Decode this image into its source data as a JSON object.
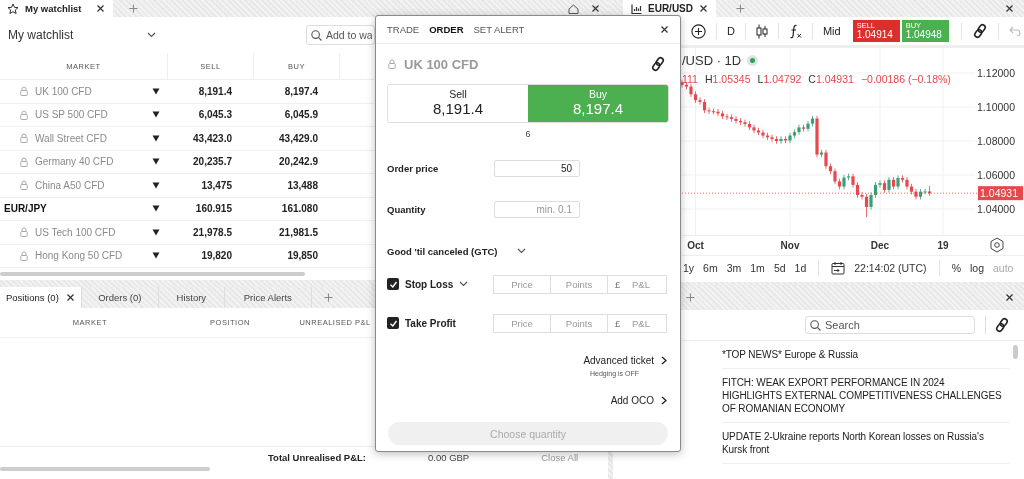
{
  "watchlist": {
    "tab": {
      "label": "My watchlist"
    },
    "title": "My watchlist",
    "search": {
      "placeholder": "Add to wa"
    },
    "columns": [
      "MARKET",
      "SELL",
      "BUY"
    ],
    "rows": [
      {
        "market": "UK 100 CFD",
        "locked": true,
        "sell": "8,191.4",
        "buy": "8,197.4"
      },
      {
        "market": "US SP 500 CFD",
        "locked": true,
        "sell": "6,045.3",
        "buy": "6,045.9"
      },
      {
        "market": "Wall Street CFD",
        "locked": true,
        "sell": "43,423.0",
        "buy": "43,429.0"
      },
      {
        "market": "Germany 40 CFD",
        "locked": true,
        "sell": "20,235.7",
        "buy": "20,242.9"
      },
      {
        "market": "China A50 CFD",
        "locked": true,
        "sell": "13,475",
        "buy": "13,488"
      },
      {
        "market": "EUR/JPY",
        "locked": false,
        "sell": "160.915",
        "buy": "161.080"
      },
      {
        "market": "US Tech 100 CFD",
        "locked": true,
        "sell": "21,978.5",
        "buy": "21,981.5"
      },
      {
        "market": "Hong Kong 50 CFD",
        "locked": true,
        "sell": "19,820",
        "buy": "19,850"
      }
    ]
  },
  "positions": {
    "tabs": [
      {
        "label": "Positions (0)",
        "selected": true
      },
      {
        "label": "Orders (0)",
        "selected": false
      },
      {
        "label": "History",
        "selected": false
      },
      {
        "label": "Price Alerts",
        "selected": false
      }
    ],
    "columns": [
      "MARKET",
      "POSITION",
      "UNREALISED P&L"
    ],
    "footer": {
      "label": "Total Unrealised P&L:",
      "value": "0.00 GBP",
      "action": "Close All"
    }
  },
  "chart": {
    "tab": {
      "label": "EUR/USD"
    },
    "toolbar": {
      "interval": "D",
      "price_type": "Mid",
      "quotes": [
        {
          "kind": "sell",
          "label": "SELL",
          "value": "1.04914"
        },
        {
          "kind": "buy",
          "label": "BUY",
          "value": "1.04948"
        }
      ]
    },
    "title": "/USD · 1D",
    "ohlc_cut": "111",
    "ohlc": [
      {
        "label": "H",
        "value": "1.05345"
      },
      {
        "label": "L",
        "value": "1.04792"
      },
      {
        "label": "C",
        "value": "1.04931"
      }
    ],
    "change": "−0.00186 (−0.18%)",
    "last_price": "1.04931",
    "chart_data": {
      "type": "candlestick",
      "categories": [
        null,
        null,
        null,
        "Oct",
        null,
        null,
        null,
        null,
        null,
        null,
        null,
        null,
        null,
        null,
        null,
        null,
        null,
        null,
        null,
        null,
        null,
        null,
        null,
        null,
        "Nov",
        null,
        null,
        null,
        null,
        null,
        null,
        null,
        null,
        null,
        null,
        null,
        null,
        null,
        null,
        null,
        null,
        null,
        null,
        null,
        "Dec",
        null,
        null,
        null,
        null,
        null,
        null,
        null,
        null,
        null,
        null,
        null,
        null,
        null,
        "19"
      ],
      "ylim": [
        1.0247,
        1.1347
      ],
      "grid": true,
      "ref_lines": [
        {
          "axis": "y",
          "value": 1.04931
        }
      ],
      "ohlc": [
        [
          1.1145,
          1.1161,
          1.1114,
          1.113
        ],
        [
          1.113,
          1.1146,
          1.1104,
          1.112
        ],
        [
          1.112,
          1.1136,
          1.1059,
          1.1075
        ],
        [
          1.1075,
          1.1091,
          1.1024,
          1.104
        ],
        [
          1.104,
          1.1056,
          1.1014,
          1.103
        ],
        [
          1.103,
          1.1046,
          1.0964,
          1.098
        ],
        [
          1.098,
          1.0996,
          1.0959,
          1.0975
        ],
        [
          1.0975,
          1.0991,
          1.0956,
          1.0972
        ],
        [
          1.0972,
          1.0988,
          1.0946,
          1.0962
        ],
        [
          1.0962,
          1.0978,
          1.0929,
          1.0945
        ],
        [
          1.0945,
          1.0961,
          1.0924,
          1.094
        ],
        [
          1.094,
          1.0956,
          1.0914,
          1.093
        ],
        [
          1.093,
          1.0946,
          1.0902,
          1.0918
        ],
        [
          1.0918,
          1.0934,
          1.0894,
          1.091
        ],
        [
          1.091,
          1.0926,
          1.0884,
          1.09
        ],
        [
          1.09,
          1.0916,
          1.0864,
          1.088
        ],
        [
          1.088,
          1.0896,
          1.0846,
          1.0862
        ],
        [
          1.0862,
          1.0878,
          1.0834,
          1.085
        ],
        [
          1.085,
          1.0866,
          1.0816,
          1.0832
        ],
        [
          1.0832,
          1.0848,
          1.0806,
          1.0822
        ],
        [
          1.0822,
          1.0838,
          1.0796,
          1.0812
        ],
        [
          1.0812,
          1.0828,
          1.0784,
          1.08
        ],
        [
          1.08,
          1.0828,
          1.0784,
          1.0812
        ],
        [
          1.0812,
          1.0828,
          1.0787,
          1.0803
        ],
        [
          1.0803,
          1.0848,
          1.0787,
          1.0832
        ],
        [
          1.0832,
          1.0868,
          1.0816,
          1.0852
        ],
        [
          1.0852,
          1.0896,
          1.0836,
          1.088
        ],
        [
          1.088,
          1.0896,
          1.0856,
          1.0872
        ],
        [
          1.0872,
          1.0918,
          1.0856,
          1.0902
        ],
        [
          1.0902,
          1.0948,
          1.0886,
          1.0932
        ],
        [
          1.0932,
          1.0948,
          1.0704,
          1.072
        ],
        [
          1.072,
          1.0748,
          1.0704,
          1.0732
        ],
        [
          1.0732,
          1.0748,
          1.0636,
          1.0652
        ],
        [
          1.0652,
          1.0668,
          1.0606,
          1.0622
        ],
        [
          1.0622,
          1.0638,
          1.0546,
          1.0562
        ],
        [
          1.0562,
          1.0578,
          1.0516,
          1.0532
        ],
        [
          1.0532,
          1.0601,
          1.0516,
          1.0585
        ],
        [
          1.0585,
          1.0608,
          1.0569,
          1.0592
        ],
        [
          1.0592,
          1.0608,
          1.0526,
          1.0542
        ],
        [
          1.0542,
          1.0558,
          1.0466,
          1.0482
        ],
        [
          1.0482,
          1.0498,
          1.0456,
          1.0472
        ],
        [
          1.0472,
          1.0488,
          1.0352,
          1.0412
        ],
        [
          1.0412,
          1.0498,
          1.0396,
          1.0482
        ],
        [
          1.0482,
          1.0558,
          1.0466,
          1.0542
        ],
        [
          1.0542,
          1.0568,
          1.0526,
          1.0552
        ],
        [
          1.0552,
          1.0568,
          1.0496,
          1.0512
        ],
        [
          1.0512,
          1.0588,
          1.0496,
          1.0572
        ],
        [
          1.0572,
          1.0588,
          1.0516,
          1.0532
        ],
        [
          1.0532,
          1.0598,
          1.0516,
          1.0582
        ],
        [
          1.0582,
          1.0598,
          1.0556,
          1.0572
        ],
        [
          1.0572,
          1.0588,
          1.0516,
          1.0532
        ],
        [
          1.0532,
          1.0548,
          1.0486,
          1.0502
        ],
        [
          1.0502,
          1.0518,
          1.0456,
          1.0472
        ],
        [
          1.0472,
          1.0518,
          1.0456,
          1.0502
        ],
        [
          1.0502,
          1.0519,
          1.0486,
          1.0503
        ],
        [
          1.0503,
          1.0535,
          1.0479,
          1.0493
        ],
        null,
        null,
        null
      ],
      "yticks": [
        {
          "value": 1.12,
          "label": "1.12000"
        },
        {
          "value": 1.1,
          "label": "1.10000"
        },
        {
          "value": 1.08,
          "label": "1.08000"
        },
        {
          "value": 1.06,
          "label": "1.06000"
        },
        {
          "value": 1.04,
          "label": "1.04000"
        }
      ]
    },
    "ranges": [
      "1y",
      "6m",
      "3m",
      "1m",
      "5d",
      "1d"
    ],
    "time": "22:14:02 (UTC)",
    "scale_options": [
      {
        "label": "%",
        "disabled": false
      },
      {
        "label": "log",
        "disabled": false
      },
      {
        "label": "auto",
        "disabled": true
      }
    ]
  },
  "news": {
    "search": {
      "placeholder": "Search"
    },
    "items": [
      "*TOP NEWS* Europe & Russia",
      "FITCH: WEAK EXPORT PERFORMANCE IN 2024 HIGHLIGHTS EXTERNAL COMPETITIVENESS CHALLENGES OF ROMANIAN ECONOMY",
      "UPDATE 2-Ukraine reports North Korean losses on Russia's Kursk front"
    ]
  },
  "order_ticket": {
    "tabs": [
      {
        "label": "TRADE",
        "selected": false
      },
      {
        "label": "ORDER",
        "selected": true
      },
      {
        "label": "SET ALERT",
        "selected": false
      }
    ],
    "instrument": "UK 100 CFD",
    "locked": true,
    "sides": [
      {
        "label": "Sell",
        "price": "8,191.4",
        "selected": false
      },
      {
        "label": "Buy",
        "price": "8,197.4",
        "selected": true
      }
    ],
    "spread": "6",
    "fields": [
      {
        "label": "Order price",
        "value": "50"
      },
      {
        "label": "Quantity",
        "placeholder": "min. 0.1"
      }
    ],
    "duration": "Good 'til canceled (GTC)",
    "protections": [
      {
        "label": "Stop Loss",
        "checked": true,
        "has_menu": true,
        "inputs": [
          {
            "placeholder": "Price"
          },
          {
            "placeholder": "Points"
          },
          {
            "currency": "£",
            "placeholder": "P&L"
          }
        ]
      },
      {
        "label": "Take Profit",
        "checked": true,
        "has_menu": false,
        "inputs": [
          {
            "placeholder": "Price"
          },
          {
            "placeholder": "Points"
          },
          {
            "currency": "£",
            "placeholder": "P&L"
          }
        ]
      }
    ],
    "links": [
      {
        "label": "Advanced ticket",
        "note": "Hedging is OFF"
      },
      {
        "label": "Add OCO"
      }
    ],
    "submit": {
      "label": "Choose quantity",
      "disabled": true
    }
  }
}
